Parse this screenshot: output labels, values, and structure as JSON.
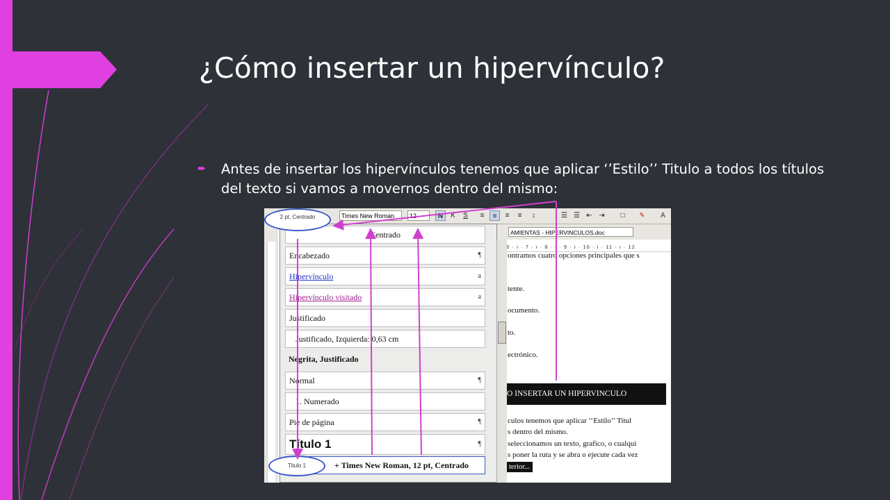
{
  "slide": {
    "title": "¿Cómo insertar un hipervínculo?",
    "bullet_text": "Antes de insertar los hipervínculos tenemos que aplicar ‘’Estilo’’ Titulo a todos los títulos del texto si vamos a movernos dentro del mismo:",
    "accent_color": "#e040e0",
    "background_color": "#2e3138"
  },
  "screenshot": {
    "toolbar": {
      "font_name": "Times New Roman",
      "font_size": "12",
      "bold_label": "N",
      "italic_label": "K",
      "underline_label": "S"
    },
    "document_name": "AMIENTAS - HIPERVINCULOS.doc",
    "ruler_text": "· · 6 · ı · 7 · ı · 8 · ı · 9 · ı · 10 · ı · 11 · ı · 12",
    "style_items": [
      {
        "label": "Centrado",
        "mark": ""
      },
      {
        "label": "Encabezado",
        "mark": "¶"
      },
      {
        "label": "Hipervínculo",
        "mark": "a"
      },
      {
        "label": "Hipervínculo visitado",
        "mark": "a"
      },
      {
        "label": "Justificado",
        "mark": ""
      },
      {
        "label": "Justificado, Izquierda:  0,63 cm",
        "mark": ""
      },
      {
        "label": "Negrita, Justificado",
        "mark": ""
      },
      {
        "label": "Normal",
        "mark": "¶"
      },
      {
        "label": "1.  Numerado",
        "mark": ""
      },
      {
        "label": "Pie de página",
        "mark": "¶"
      },
      {
        "label": "Título 1",
        "mark": "¶"
      },
      {
        "label": "+ Times New Roman, 12 pt, Centrado",
        "mark": ""
      }
    ],
    "doc_lines": [
      "ontramos cuatro opciones principales que s",
      "tente.",
      "ocumento.",
      "to.",
      "ectrónico."
    ],
    "heading_bar": "O INSERTAR UN HIPERVINCULO",
    "body_lines": [
      "culos tenemos que aplicar ‘‘Estilo’’ Titul",
      "s dentro del mismo.",
      "seleccionamos un texto, grafico, o cualqui",
      "s poner la ruta y se abra o ejecute cada vez"
    ],
    "anterior_label": "terior..."
  },
  "callouts": {
    "top": "2 pt, Centrado",
    "bottom": "Titulo 1"
  }
}
